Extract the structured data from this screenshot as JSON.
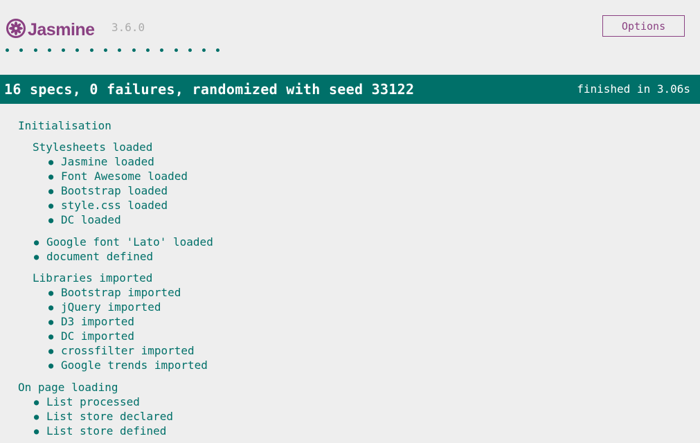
{
  "banner": {
    "logo_text": "Jasmine",
    "version": "3.6.0",
    "options_label": "Options",
    "spec_dot_count": 16
  },
  "summary": {
    "text": "16 specs, 0 failures, randomized with seed 33122",
    "duration": "finished in 3.06s"
  },
  "results": {
    "initialisation": "Initialisation",
    "stylesheets": "Stylesheets loaded",
    "stylesheet_specs": [
      "Jasmine loaded",
      "Font Awesome loaded",
      "Bootstrap loaded",
      "style.css loaded",
      "DC loaded"
    ],
    "init_specs": [
      "Google font 'Lato' loaded",
      "document defined"
    ],
    "libraries": "Libraries imported",
    "library_specs": [
      "Bootstrap imported",
      "jQuery imported",
      "D3 imported",
      "DC imported",
      "crossfilter imported",
      "Google trends imported"
    ],
    "on_page_loading": "On page loading",
    "page_specs": [
      "List processed",
      "List store declared",
      "List store defined"
    ]
  },
  "colors": {
    "passed": "#007069",
    "brand": "#8a4182",
    "background": "#eeeeee"
  }
}
